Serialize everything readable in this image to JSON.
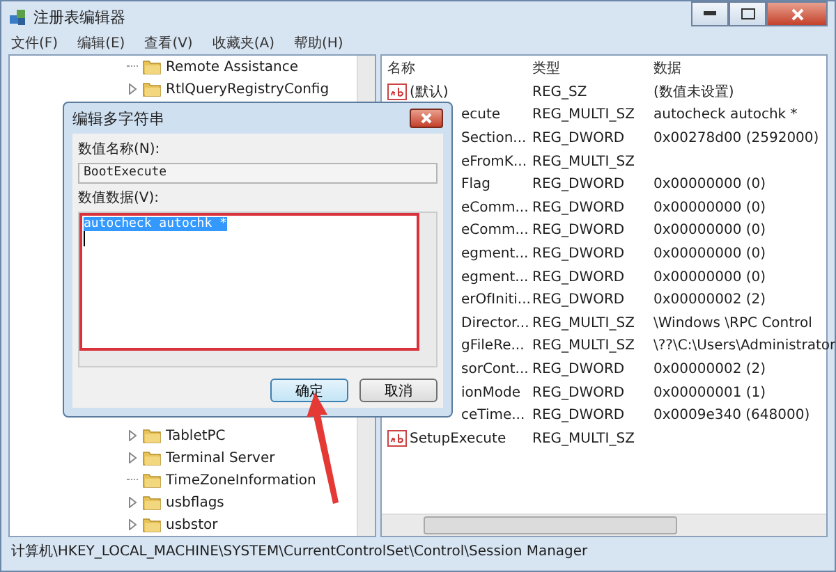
{
  "window": {
    "title": "注册表编辑器"
  },
  "menu": [
    "文件(F)",
    "编辑(E)",
    "查看(V)",
    "收藏夹(A)",
    "帮助(H)"
  ],
  "tree": {
    "items_top": [
      {
        "label": "Remote Assistance",
        "expandable": false
      },
      {
        "label": "RtlQueryRegistryConfig",
        "expandable": true
      }
    ],
    "items_bottom": [
      {
        "label": "TabletPC",
        "expandable": true
      },
      {
        "label": "Terminal Server",
        "expandable": true
      },
      {
        "label": "TimeZoneInformation",
        "expandable": false
      },
      {
        "label": "usbflags",
        "expandable": true
      },
      {
        "label": "usbstor",
        "expandable": true
      }
    ]
  },
  "list": {
    "columns": [
      "名称",
      "类型",
      "数据"
    ],
    "rows": [
      {
        "name": "(默认)",
        "type": "REG_SZ",
        "data": "(数值未设置)",
        "kind": "string"
      },
      {
        "name": "ecute",
        "type": "REG_MULTI_SZ",
        "data": "autocheck autochk *"
      },
      {
        "name": "Section...",
        "type": "REG_DWORD",
        "data": "0x00278d00 (2592000)"
      },
      {
        "name": "eFromK...",
        "type": "REG_MULTI_SZ"
      },
      {
        "name": "Flag",
        "type": "REG_DWORD",
        "data": "0x00000000 (0)"
      },
      {
        "name": "eComm...",
        "type": "REG_DWORD",
        "data": "0x00000000 (0)"
      },
      {
        "name": "eComm...",
        "type": "REG_DWORD",
        "data": "0x00000000 (0)"
      },
      {
        "name": "egment...",
        "type": "REG_DWORD",
        "data": "0x00000000 (0)"
      },
      {
        "name": "egment...",
        "type": "REG_DWORD",
        "data": "0x00000000 (0)"
      },
      {
        "name": "erOfIniti...",
        "type": "REG_DWORD",
        "data": "0x00000002 (2)"
      },
      {
        "name": "Director...",
        "type": "REG_MULTI_SZ",
        "data": "\\Windows \\RPC Control"
      },
      {
        "name": "gFileRe...",
        "type": "REG_MULTI_SZ",
        "data": "\\??\\C:\\Users\\Administrator"
      },
      {
        "name": "sorCont...",
        "type": "REG_DWORD",
        "data": "0x00000002 (2)"
      },
      {
        "name": "ionMode",
        "type": "REG_DWORD",
        "data": "0x00000001 (1)"
      },
      {
        "name": "ceTime...",
        "type": "REG_DWORD",
        "data": "0x0009e340 (648000)"
      },
      {
        "name": "SetupExecute",
        "type": "REG_MULTI_SZ",
        "kind": "string"
      }
    ]
  },
  "dialog": {
    "title": "编辑多字符串",
    "name_label": "数值名称(N):",
    "name_value": "BootExecute",
    "data_label": "数值数据(V):",
    "data_value": "autocheck autochk *",
    "data_selected": true,
    "buttons": [
      {
        "label": "确定",
        "default": true
      },
      {
        "label": "取消",
        "default": false
      }
    ]
  },
  "status_bar": "计算机\\HKEY_LOCAL_MACHINE\\SYSTEM\\CurrentControlSet\\Control\\Session Manager"
}
